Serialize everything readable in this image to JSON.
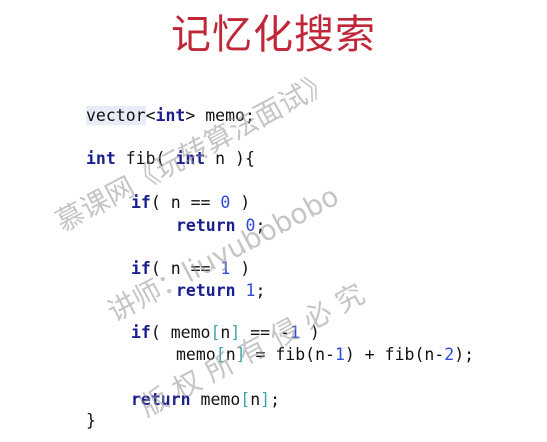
{
  "title": "记忆化搜索",
  "code": {
    "line1": {
      "type": "vector",
      "lt": "<",
      "int": "int",
      "gt": ">",
      "rest": " memo;"
    },
    "line2": {
      "kw1": "int",
      "mid": " fib( ",
      "kw2": "int",
      "rest": " n ){"
    },
    "line3": {
      "kw": "if",
      "a": "( n == ",
      "num": "0",
      "b": " )"
    },
    "line4": {
      "kw": "return",
      "sp": " ",
      "num": "0",
      "end": ";"
    },
    "line5": {
      "kw": "if",
      "a": "( n == ",
      "num": "1",
      "b": " )"
    },
    "line6": {
      "kw": "return",
      "sp": " ",
      "num": "1",
      "end": ";"
    },
    "line7": {
      "kw": "if",
      "a": "( memo",
      "lb": "[",
      "n": "n",
      "rb": "]",
      "b": " == -",
      "num": "1",
      "c": " )"
    },
    "line8": {
      "a": "memo",
      "lb": "[",
      "n": "n",
      "rb": "]",
      "b": " = fib(n-",
      "num1": "1",
      "c": ") + fib(n-",
      "num2": "2",
      "d": ");"
    },
    "line9": {
      "kw": "return",
      "a": " memo",
      "lb": "[",
      "n": "n",
      "rb": "]",
      "end": ";"
    },
    "line10": "}"
  },
  "watermark": {
    "line1": "慕课网《玩转算法面试》",
    "line2": "讲师：liuyubobobo",
    "line3": "版  权  所  有    侵    必  究"
  }
}
